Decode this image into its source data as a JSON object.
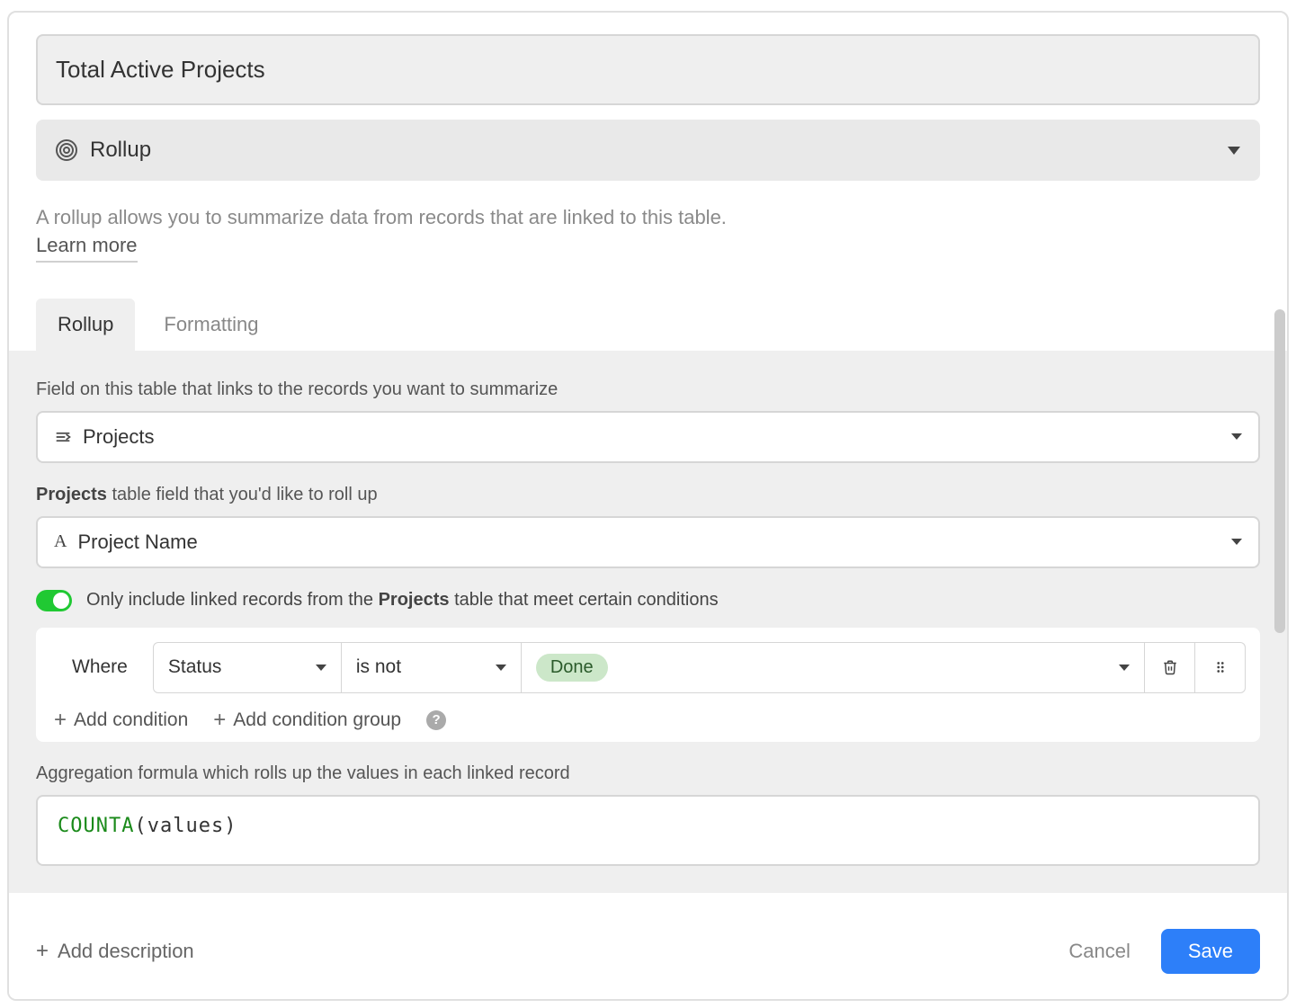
{
  "field_name": "Total Active Projects",
  "field_type": {
    "label": "Rollup"
  },
  "description": "A rollup allows you to summarize data from records that are linked to this table.",
  "learn_more": "Learn more",
  "tabs": {
    "rollup": "Rollup",
    "formatting": "Formatting"
  },
  "link_field": {
    "label": "Field on this table that links to the records you want to summarize",
    "value": "Projects"
  },
  "rollup_field": {
    "label_prefix": "Projects",
    "label_suffix": " table field that you'd like to roll up",
    "value": "Project Name"
  },
  "filter": {
    "toggle_text_pre": "Only include linked records from the ",
    "toggle_text_table": "Projects",
    "toggle_text_post": " table that meet certain conditions",
    "where": "Where",
    "field": "Status",
    "operator": "is not",
    "value": "Done",
    "add_condition": "Add condition",
    "add_condition_group": "Add condition group"
  },
  "aggregation": {
    "label": "Aggregation formula which rolls up the values in each linked record",
    "fn": "COUNTA",
    "arg": "values"
  },
  "footer": {
    "add_description": "Add description",
    "cancel": "Cancel",
    "save": "Save"
  }
}
